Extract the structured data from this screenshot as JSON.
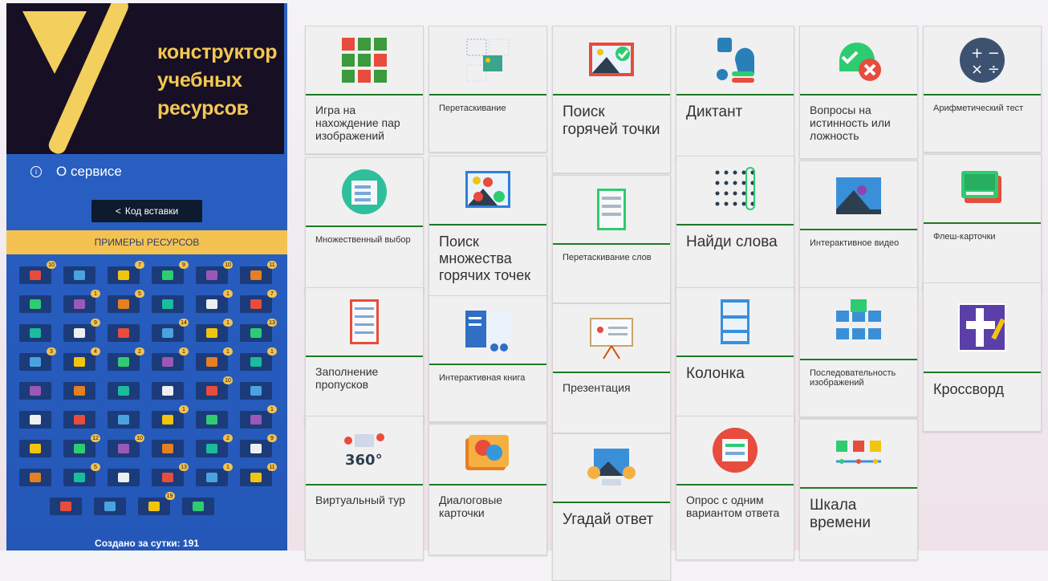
{
  "logo": {
    "text_lines": [
      "конструктор",
      "учебных",
      "ресурсов"
    ]
  },
  "sidebar": {
    "about_label": "О сервисе",
    "embed_label": "Код вставки",
    "examples_label": "ПРИМЕРЫ РЕСУРСОВ",
    "created_label": "Создано за сутки: 191",
    "icon_rows": [
      [
        "10",
        "",
        "7",
        "9",
        "10",
        "11"
      ],
      [
        "",
        "1",
        "5",
        "",
        "1",
        "7"
      ],
      [
        "",
        "9",
        "",
        "14",
        "1",
        "13"
      ],
      [
        "3",
        "4",
        "2",
        "1",
        "1",
        "1"
      ],
      [
        "",
        "",
        "",
        "",
        "10",
        ""
      ],
      [
        "",
        "",
        "",
        "1",
        "",
        "1"
      ],
      [
        "",
        "12",
        "10",
        "",
        "2",
        "9"
      ],
      [
        "",
        "5",
        "",
        "13",
        "1",
        "11"
      ],
      [
        "",
        "",
        "19",
        ""
      ]
    ]
  },
  "cards": [
    {
      "label": "Игра на нахождение пар изображений",
      "size": "m",
      "icon": "grid-pairs-icon"
    },
    {
      "label": "Перетаскивание",
      "size": "s",
      "icon": "drag-drop-icon"
    },
    {
      "label": "Поиск горячей точки",
      "size": "xl",
      "icon": "hotspot-icon"
    },
    {
      "label": "Диктант",
      "size": "xl",
      "icon": "dictation-icon"
    },
    {
      "label": "Вопросы на истинность или ложность",
      "size": "m",
      "icon": "true-false-icon"
    },
    {
      "label": "Арифметический тест",
      "size": "s",
      "icon": "arithmetic-icon"
    },
    {
      "label": "Множественный выбор",
      "size": "s",
      "icon": "multiple-choice-icon"
    },
    {
      "label": "Поиск множества горячих точек",
      "size": "l",
      "icon": "multi-hotspot-icon"
    },
    {
      "label": "Перетаскивание слов",
      "size": "s",
      "icon": "drag-words-icon"
    },
    {
      "label": "Найди слова",
      "size": "xl",
      "icon": "find-words-icon"
    },
    {
      "label": "Интерактивное видео",
      "size": "s",
      "icon": "interactive-video-icon"
    },
    {
      "label": "Флеш-карточки",
      "size": "s",
      "icon": "flashcards-icon"
    },
    {
      "label": "Заполнение пропусков",
      "size": "m",
      "icon": "fill-blanks-icon"
    },
    {
      "label": "Интерактивная книга",
      "size": "s",
      "icon": "interactive-book-icon"
    },
    {
      "label": "Презентация",
      "size": "m",
      "icon": "presentation-icon"
    },
    {
      "label": "Колонка",
      "size": "xl",
      "icon": "column-icon"
    },
    {
      "label": "Последовательность изображений",
      "size": "s",
      "icon": "image-sequence-icon"
    },
    {
      "label": "Кроссворд",
      "size": "l",
      "icon": "crossword-icon"
    },
    {
      "label": "Виртуальный тур",
      "size": "m",
      "icon": "virtual-tour-icon"
    },
    {
      "label": "Диалоговые карточки",
      "size": "m",
      "icon": "dialog-cards-icon"
    },
    {
      "label": "Угадай ответ",
      "size": "xl",
      "icon": "guess-answer-icon"
    },
    {
      "label": "Опрос с одним вариантом ответа",
      "size": "m",
      "icon": "single-choice-icon"
    },
    {
      "label": "Шкала времени",
      "size": "xl",
      "icon": "timeline-icon"
    }
  ],
  "colors": {
    "sidebar": "#2a62c4",
    "logo_bg": "#170f24",
    "accent": "#f3c251",
    "card_line": "#1e7a23"
  }
}
